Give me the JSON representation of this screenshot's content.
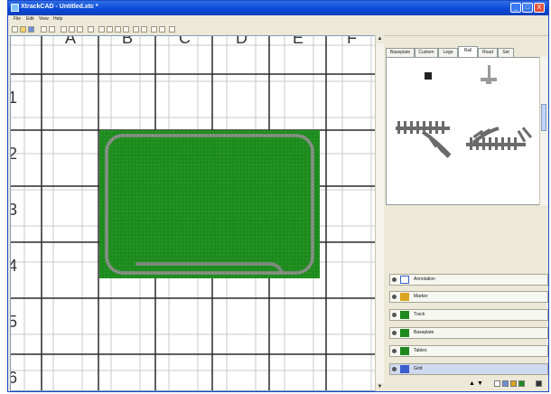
{
  "window": {
    "title": "XtrackCAD - Untitled.xtc *",
    "minimize": "_",
    "maximize": "□",
    "close": "X"
  },
  "menu": [
    "File",
    "Edit",
    "View",
    "Help"
  ],
  "grid": {
    "column_labels": [
      "A",
      "B",
      "C",
      "D",
      "E",
      "F"
    ],
    "row_labels": [
      "1",
      "2",
      "3",
      "4",
      "5",
      "6"
    ]
  },
  "panel": {
    "tabs": [
      "Baseplate",
      "Custom",
      "Lego",
      "Rail",
      "Road",
      "Set"
    ],
    "active_tab": "Rail",
    "layers": [
      {
        "name": "Annotation",
        "color": "#3a5fcd"
      },
      {
        "name": "Marker",
        "color": "#d9a520"
      },
      {
        "name": "Track",
        "color": "#1e8a1e"
      },
      {
        "name": "Baseplate",
        "color": "#1e8a1e"
      },
      {
        "name": "Tables",
        "color": "#1e8a1e"
      },
      {
        "name": "Grid",
        "color": "#3a5fcd"
      }
    ]
  },
  "colors": {
    "baseplate": "#1e8a1e",
    "track": "#7a8a7a",
    "titlebar": "#0a46d6"
  }
}
